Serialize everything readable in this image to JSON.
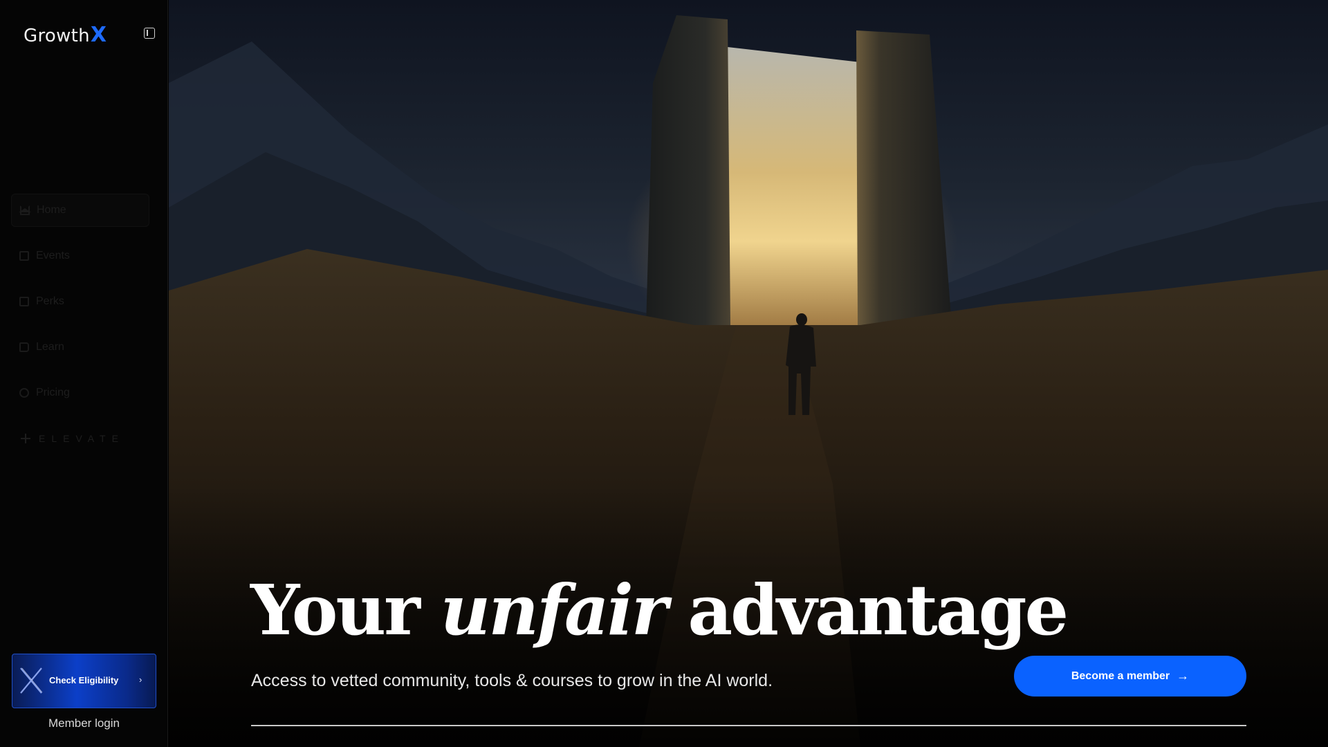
{
  "brand": {
    "name": "Growth",
    "mark": "X",
    "accent": "#1e6bff"
  },
  "sidebar": {
    "collapse_icon": "sidebar-toggle-icon",
    "items": [
      {
        "label": "Home",
        "icon": "home-icon"
      },
      {
        "label": "Events",
        "icon": "calendar-icon"
      },
      {
        "label": "Perks",
        "icon": "gift-icon"
      },
      {
        "label": "Learn",
        "icon": "book-icon"
      },
      {
        "label": "Pricing",
        "icon": "tag-icon"
      }
    ],
    "elevate_label": "ELEVATE",
    "check_eligibility": {
      "label": "Check Eligibility",
      "chevron": "›"
    },
    "member_login": "Member login"
  },
  "hero": {
    "headline_before": "Your ",
    "headline_italic": "unfair",
    "headline_after": " advantage",
    "subhead": "Access to vetted community, tools & courses to grow in the AI world.",
    "cta_label": "Become a member",
    "cta_arrow": "→",
    "cta_color": "#0a62ff"
  }
}
